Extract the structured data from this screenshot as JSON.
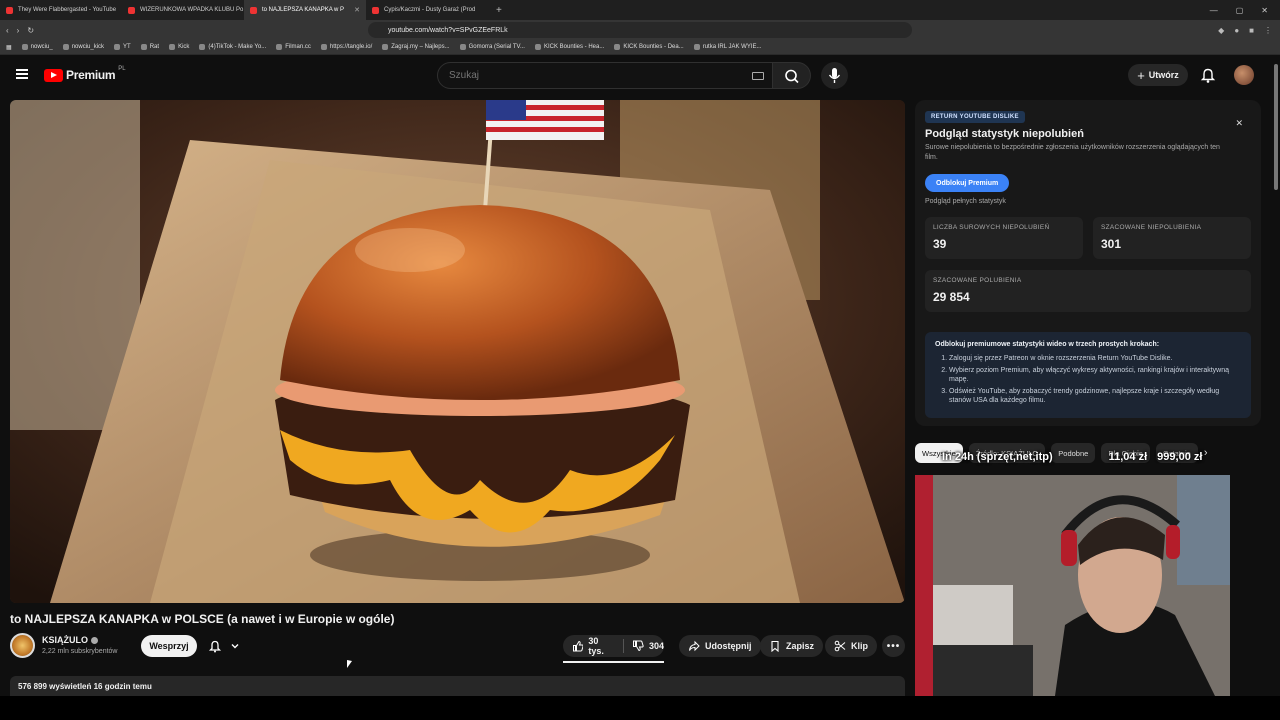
{
  "browser": {
    "tabs": [
      {
        "title": "They Were Flabbergasted - YouTube",
        "active": false
      },
      {
        "title": "WIZERUNKOWA WPADKA KLUBU Po",
        "active": false
      },
      {
        "title": "to NAJLEPSZA KANAPKA w P",
        "active": true
      },
      {
        "title": "Cypis/Kaczmi - Dusty Garaż (Prod",
        "active": false
      }
    ],
    "url": "youtube.com/watch?v=SPvGZEeFRLk",
    "bookmarks": [
      "nowciu_",
      "nowciu_kick",
      "YT",
      "Rat",
      "Kick",
      "(4)TikTok - Make Yo...",
      "Filman.cc",
      "https://tangle.io/",
      "Zagraj.my – Najleps...",
      "Gomorra (Serial TV...",
      "KICK Bounties - Hea...",
      "KICK Bounties - Dea...",
      "rutka IRL JAK WYIE..."
    ]
  },
  "header": {
    "logo_text": "Premium",
    "logo_region": "PL",
    "search_placeholder": "Szukaj",
    "create_label": "Utwórz"
  },
  "video": {
    "title": "to NAJLEPSZA KANAPKA w POLSCE (a nawet i w Europie w ogóle)",
    "channel": "KSIĄŻULO",
    "subscribers": "2,22 mln subskrybentów",
    "support_label": "Wesprzyj",
    "likes": "30 tys.",
    "dislikes": "304",
    "share_label": "Udostępnij",
    "save_label": "Zapisz",
    "clip_label": "Klip",
    "views_date": "576 899 wyświetleń  16 godzin temu"
  },
  "rd_panel": {
    "badge": "RETURN YOUTUBE DISLIKE",
    "title": "Podgląd statystyk niepolubień",
    "subtitle": "Surowe niepolubienia to bezpośrednie zgłoszenia użytkowników rozszerzenia oglądających ten film.",
    "unlock_button": "Odblokuj Premium",
    "note": "Podgląd pełnych statystyk",
    "stats": [
      {
        "label": "LICZBA SUROWYCH NIEPOLUBIEŃ",
        "value": "39"
      },
      {
        "label": "SZACOWANE NIEPOLUBIENIA",
        "value": "301"
      },
      {
        "label": "SZACOWANE POLUBIENIA",
        "value": "29 854"
      }
    ],
    "steps_title": "Odblokuj premiumowe statystyki wideo w trzech prostych krokach:",
    "steps": [
      "Zaloguj się przez Patreon w oknie rozszerzenia Return YouTube Dislike.",
      "Wybierz poziom Premium, aby włączyć wykresy aktywności, rankingi krajów i interaktywną mapę.",
      "Odśwież YouTube, aby zobaczyć trendy godzinowe, najlepsze kraje i szczegóły według stanów USA dla każdego filmu."
    ]
  },
  "chips": [
    "Wszystkie",
    "Źródło: KSIĄŻULO",
    "Podobne",
    "Dla Ciebie",
    "Ostatnio"
  ],
  "overlay": {
    "label": "In 24h (sprzęt,net,itp)",
    "amount1": "11,04 zł",
    "amount2": "999,00 zł"
  },
  "colors": {
    "accent": "#ff0000",
    "rd_button": "#3b82f6",
    "background": "#0f0f0f"
  }
}
